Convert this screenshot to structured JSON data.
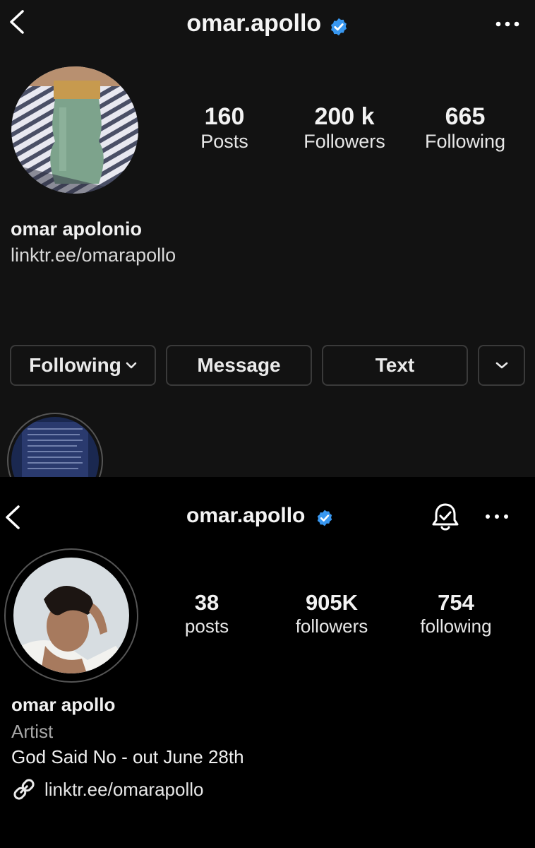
{
  "top": {
    "handle": "omar.apollo",
    "stats": [
      {
        "value": "160",
        "label": "Posts"
      },
      {
        "value": "200 k",
        "label": "Followers"
      },
      {
        "value": "665",
        "label": "Following"
      }
    ],
    "name": "omar apolonio",
    "link": "linktr.ee/omarapollo",
    "buttons": {
      "following": "Following",
      "message": "Message",
      "text": "Text"
    },
    "icons": [
      "back-icon",
      "verified-badge-icon",
      "more-icon",
      "chevron-down-icon"
    ]
  },
  "bottom": {
    "handle": "omar.apollo",
    "stats": [
      {
        "value": "38",
        "label": "posts"
      },
      {
        "value": "905K",
        "label": "followers"
      },
      {
        "value": "754",
        "label": "following"
      }
    ],
    "name": "omar apollo",
    "category": "Artist",
    "bio": "God Said No - out June 28th",
    "link": "linktr.ee/omarapollo",
    "icons": [
      "back-icon",
      "verified-badge-icon",
      "notification-bell-icon",
      "more-icon",
      "link-icon"
    ]
  },
  "colors": {
    "verified": "#3897f0",
    "top_bg": "#121212",
    "bottom_bg": "#000000"
  }
}
